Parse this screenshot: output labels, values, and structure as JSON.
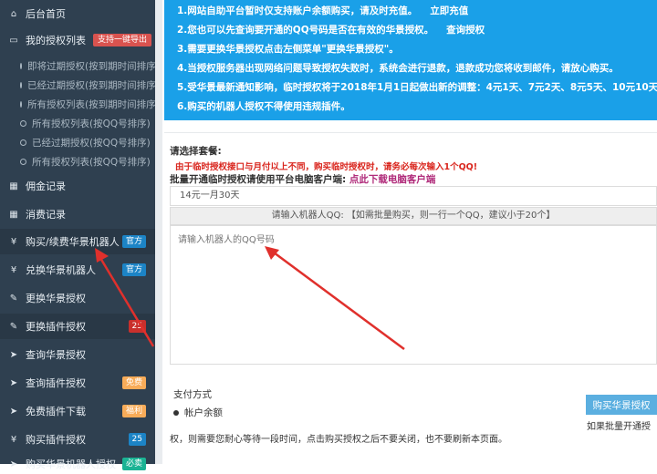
{
  "sidebar": {
    "items": [
      {
        "label": "后台首页",
        "icon": "home-icon",
        "kind": "main"
      },
      {
        "label": "我的授权列表",
        "icon": "laptop-icon",
        "kind": "main",
        "badge": "支持一键导出",
        "badge_color": "#d9534f"
      },
      {
        "label": "即将过期授权(按到期时间排序)",
        "kind": "sub"
      },
      {
        "label": "已经过期授权(按到期时间排序)",
        "kind": "sub"
      },
      {
        "label": "所有授权列表(按到期时间排序)",
        "kind": "sub"
      },
      {
        "label": "所有授权列表(按QQ号排序)",
        "kind": "sub"
      },
      {
        "label": "已经过期授权(按QQ号排序)",
        "kind": "sub"
      },
      {
        "label": "所有授权列表(按QQ号排序)",
        "kind": "sub"
      },
      {
        "label": "佣金记录",
        "icon": "table-icon",
        "kind": "main"
      },
      {
        "label": "消费记录",
        "icon": "table-icon",
        "kind": "main"
      },
      {
        "label": "购买/续费华景机器人",
        "icon": "yen-icon",
        "kind": "main",
        "badge": "官方",
        "badge_color": "#1c84c6"
      },
      {
        "label": "兑换华景机器人",
        "icon": "yen-icon",
        "kind": "main",
        "badge": "官方",
        "badge_color": "#1c84c6"
      },
      {
        "label": "更换华景授权",
        "icon": "edit-icon",
        "kind": "main"
      },
      {
        "label": "更换插件授权",
        "icon": "edit-icon",
        "kind": "main",
        "badge": "25",
        "badge_color": "#c9302c"
      },
      {
        "label": "查询华景授权",
        "icon": "send-icon",
        "kind": "main"
      },
      {
        "label": "查询插件授权",
        "icon": "send-icon",
        "kind": "main",
        "badge": "免费",
        "badge_color": "#f8ac59"
      },
      {
        "label": "免费插件下载",
        "icon": "send-icon",
        "kind": "main",
        "badge": "福利",
        "badge_color": "#f8ac59"
      },
      {
        "label": "购买插件授权",
        "icon": "yen-icon",
        "kind": "main",
        "badge": "25",
        "badge_color": "#1c84c6"
      },
      {
        "label": "购买华景机器人授权",
        "icon": "send-icon",
        "kind": "main",
        "badge": "必卖",
        "badge_color": "#1ab394"
      }
    ]
  },
  "notice": {
    "lines": [
      {
        "text": "1.网站自助平台暂时仅支持账户余额购买，请及时充值。",
        "link": "立即充值"
      },
      {
        "text": "2.您也可以先查询要开通的QQ号码是否在有效的华景授权。",
        "link": "查询授权"
      },
      {
        "text": "3.需要更换华景授权点击左侧菜单\"更换华景授权\"。",
        "link": ""
      },
      {
        "text": "4.当授权服务器出现网络问题导致授权失败时，系统会进行退款，退款成功您将收到邮件，请放心购买。",
        "link": ""
      },
      {
        "text": "5.受华景最新通知影响，临时授权将于2018年1月1日起做出新的调整：4元1天、7元2天、8元5天、10元10天。",
        "link": ""
      },
      {
        "text": "6.购买的机器人授权不得使用违规插件。",
        "link": ""
      }
    ]
  },
  "form": {
    "package_label": "请选择套餐:",
    "temp_warning": "由于临时授权接口与月付以上不同，购买临时授权时，请务必每次输入1个QQ!",
    "batch_label": "批量开通临时授权请使用平台电脑客户端:",
    "batch_link": "点此下载电脑客户端",
    "package_selected": "14元一月30天",
    "qq_header": "请输入机器人QQ: 【如需批量购买，则一行一个QQ，建议小于20个】",
    "qq_placeholder": "请输入机器人的QQ号码",
    "payment_label": "支付方式",
    "payment_option": "帐户余额",
    "buy_button": "购买华景授权",
    "batch_note": "如果批量开通授",
    "wait_note": "权，则需要您耐心等待一段时间，点击购买授权之后不要关闭，也不要刷新本页面。"
  },
  "colors": {
    "sidebar_bg": "#2f4050",
    "notice_bg": "#1aa0e8",
    "arrow": "#e0302c",
    "buy_button": "#5bafe0"
  }
}
